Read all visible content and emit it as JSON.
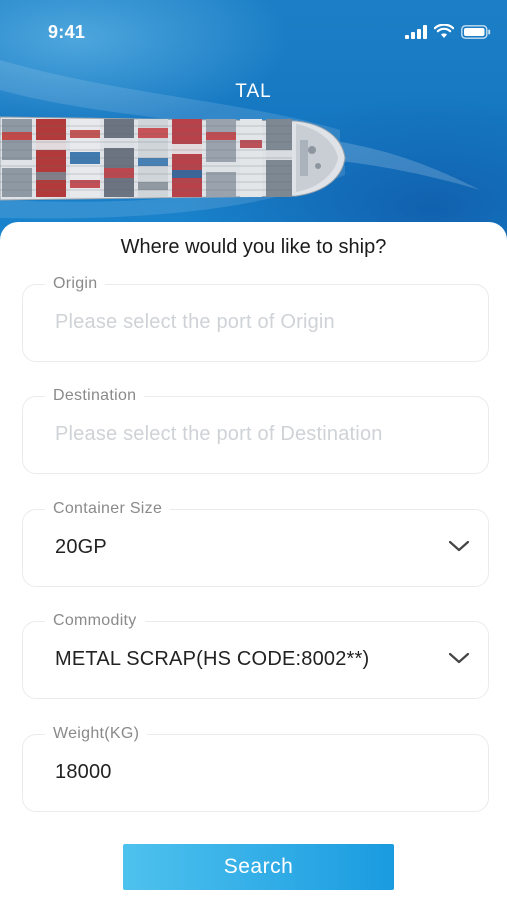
{
  "status_bar": {
    "time": "9:41",
    "icons": [
      "cellular-signal-icon",
      "wifi-icon",
      "battery-icon"
    ]
  },
  "header": {
    "title": "TAL",
    "hero_image": "container-ship"
  },
  "form": {
    "heading": "Where would you like to ship?",
    "origin": {
      "label": "Origin",
      "placeholder": "Please select the port of Origin",
      "value": ""
    },
    "destination": {
      "label": "Destination",
      "placeholder": "Please select the port of Destination",
      "value": ""
    },
    "container_size": {
      "label": "Container Size",
      "value": "20GP",
      "icon": "chevron-down-icon"
    },
    "commodity": {
      "label": "Commodity",
      "value": "METAL SCRAP(HS CODE:8002**)",
      "icon": "chevron-down-icon"
    },
    "weight": {
      "label": "Weight(KG)",
      "value": "18000"
    },
    "search_label": "Search"
  },
  "colors": {
    "sea": "#1678c2",
    "accent_gradient_start": "#4ec2ee",
    "accent_gradient_end": "#1a9be0",
    "border": "#e9ebee",
    "placeholder": "#cfd2d6"
  }
}
